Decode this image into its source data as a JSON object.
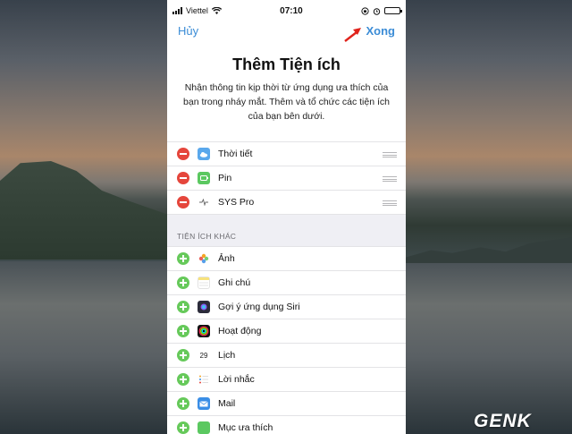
{
  "status_bar": {
    "carrier": "Viettel",
    "time": "07:10",
    "battery_level": 0.8
  },
  "nav": {
    "cancel_label": "Hủy",
    "done_label": "Xong"
  },
  "header": {
    "title": "Thêm Tiện ích",
    "description": "Nhận thông tin kịp thời từ ứng dụng ưa thích của bạn trong nháy mắt. Thêm và tổ chức các tiện ích của bạn bên dưới."
  },
  "active_widgets": [
    {
      "label": "Thời tiết",
      "icon": "weather-icon",
      "icon_color": "#5aa8ec"
    },
    {
      "label": "Pin",
      "icon": "battery-widget-icon",
      "icon_color": "#5bc860"
    },
    {
      "label": "SYS Pro",
      "icon": "pulse-icon",
      "icon_color": "#ffffff"
    }
  ],
  "more_section_title": "TIỆN ÍCH KHÁC",
  "more_widgets": [
    {
      "label": "Ảnh",
      "icon": "photos-icon",
      "icon_color": "#f5a623"
    },
    {
      "label": "Ghi chú",
      "icon": "notes-icon",
      "icon_color": "#f7e27c"
    },
    {
      "label": "Gợi ý ứng dụng Siri",
      "icon": "siri-icon",
      "icon_color": "#2b2b3a"
    },
    {
      "label": "Hoạt động",
      "icon": "activity-icon",
      "icon_color": "#111111"
    },
    {
      "label": "Lịch",
      "icon": "calendar-icon",
      "icon_color": "#ffffff",
      "icon_text": "29"
    },
    {
      "label": "Lời nhắc",
      "icon": "reminders-icon",
      "icon_color": "#ffffff"
    },
    {
      "label": "Mail",
      "icon": "mail-icon",
      "icon_color": "#3a8ee6"
    },
    {
      "label": "Mục ưa thích",
      "icon": "favorites-icon",
      "icon_color": "#5bc860"
    }
  ],
  "watermark": "GENK",
  "colors": {
    "accent": "#3b8cd6",
    "remove": "#e5463c",
    "add": "#66c95a",
    "arrow": "#e0231c"
  }
}
